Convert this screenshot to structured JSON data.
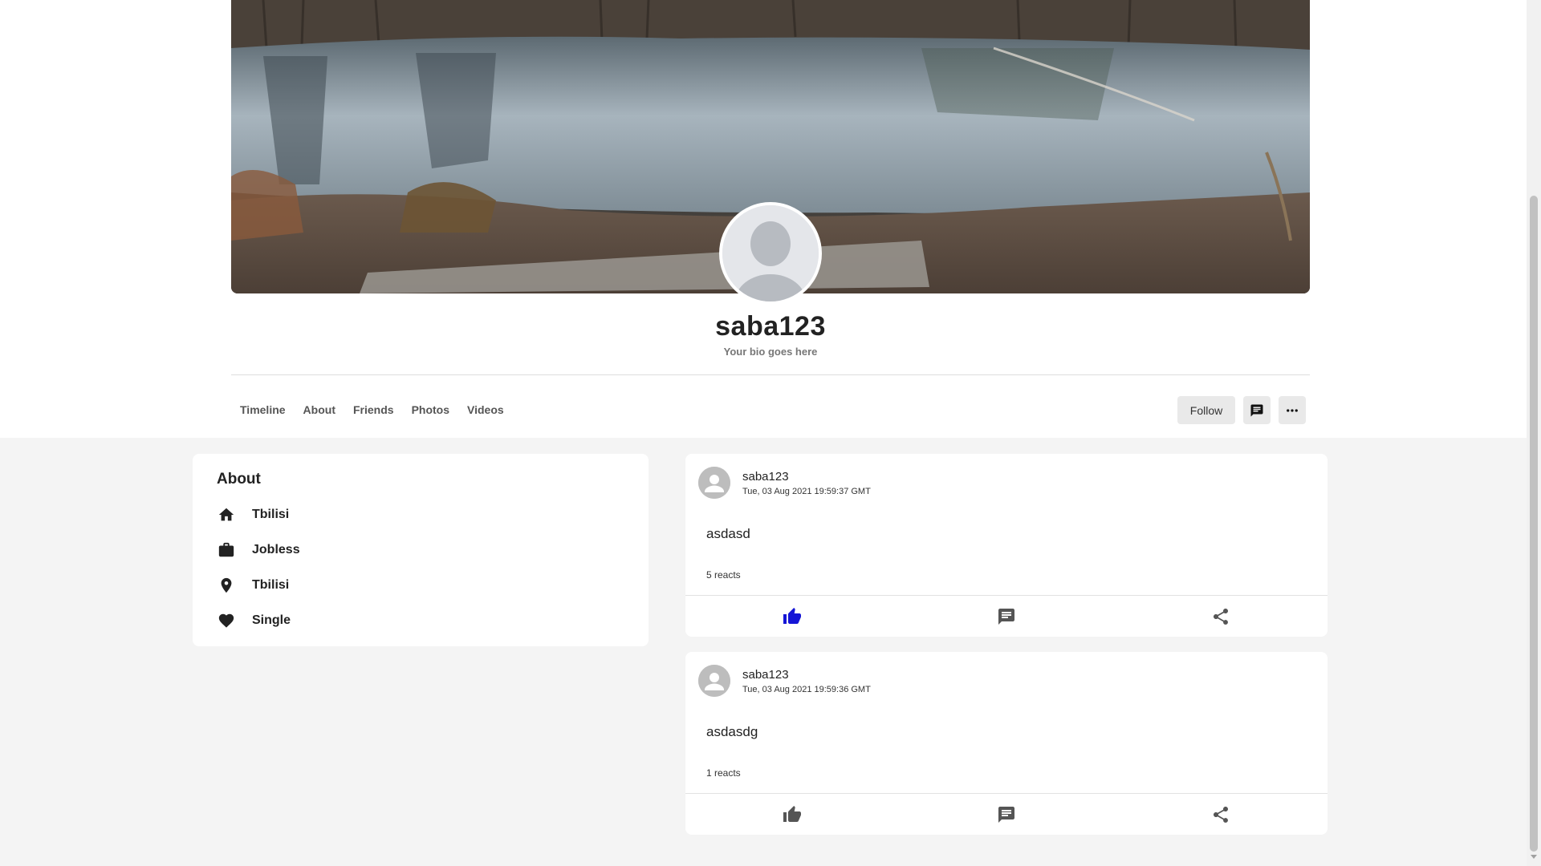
{
  "profile": {
    "username": "saba123",
    "bio": "Your bio goes here",
    "cover_image": "lake-landscape"
  },
  "nav": {
    "items": [
      "Timeline",
      "About",
      "Friends",
      "Photos",
      "Videos"
    ]
  },
  "actions": {
    "follow_label": "Follow",
    "message_icon": "message-icon",
    "more_icon": "more-icon"
  },
  "about": {
    "title": "About",
    "items": [
      {
        "icon": "home-icon",
        "label": "Tbilisi"
      },
      {
        "icon": "briefcase-icon",
        "label": "Jobless"
      },
      {
        "icon": "location-pin-icon",
        "label": "Tbilisi"
      },
      {
        "icon": "heart-icon",
        "label": "Single"
      }
    ]
  },
  "posts": [
    {
      "author": "saba123",
      "timestamp": "Tue, 03 Aug 2021 19:59:37 GMT",
      "text": "asdasd",
      "reacts": "5 reacts",
      "liked": true
    },
    {
      "author": "saba123",
      "timestamp": "Tue, 03 Aug 2021 19:59:36 GMT",
      "text": "asdasdg",
      "reacts": "1 reacts",
      "liked": false
    }
  ],
  "colors": {
    "like_active": "#1515d6",
    "icon_inactive": "#555555",
    "page_bg": "#f4f4f4"
  }
}
